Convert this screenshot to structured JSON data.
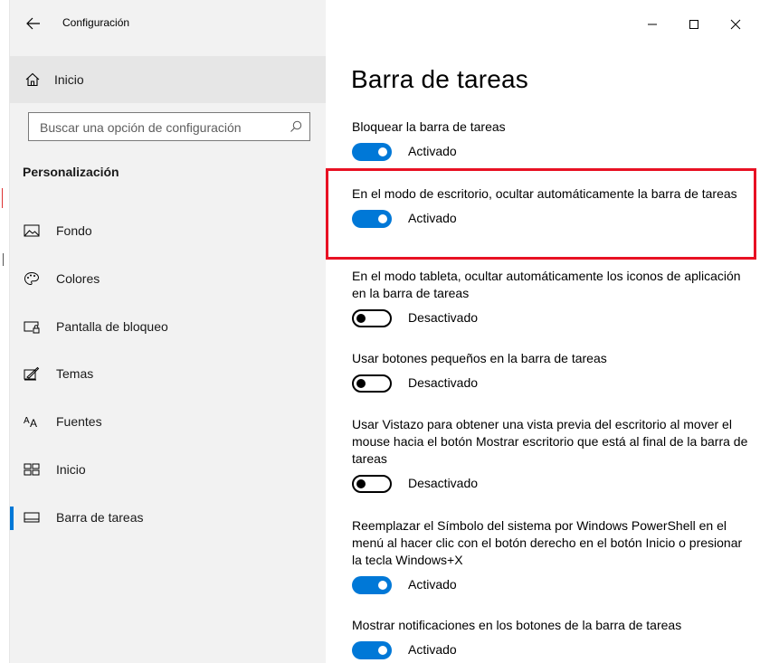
{
  "window": {
    "title": "Configuración",
    "controls": [
      "minimize-icon",
      "maximize-icon",
      "close-icon"
    ]
  },
  "sidebar": {
    "home_label": "Inicio",
    "search_placeholder": "Buscar una opción de configuración",
    "section_title": "Personalización",
    "items": [
      {
        "label": "Fondo",
        "icon": "picture-icon"
      },
      {
        "label": "Colores",
        "icon": "palette-icon"
      },
      {
        "label": "Pantalla de bloqueo",
        "icon": "lock-screen-icon"
      },
      {
        "label": "Temas",
        "icon": "themes-icon"
      },
      {
        "label": "Fuentes",
        "icon": "fonts-icon"
      },
      {
        "label": "Inicio",
        "icon": "start-menu-icon"
      },
      {
        "label": "Barra de tareas",
        "icon": "taskbar-icon",
        "active": true
      }
    ]
  },
  "main": {
    "title": "Barra de tareas",
    "settings": [
      {
        "description": "Bloquear la barra de tareas",
        "state": "on",
        "state_label": "Activado"
      },
      {
        "description": "En el modo de escritorio, ocultar automáticamente la barra de tareas",
        "state": "on",
        "state_label": "Activado",
        "highlighted": true
      },
      {
        "description": "En el modo tableta, ocultar automáticamente los iconos de aplicación en la barra de tareas",
        "state": "off",
        "state_label": "Desactivado"
      },
      {
        "description": "Usar botones pequeños en la barra de tareas",
        "state": "off",
        "state_label": "Desactivado"
      },
      {
        "description": "Usar Vistazo para obtener una vista previa del escritorio al mover el mouse hacia el botón Mostrar escritorio que está al final de la barra de tareas",
        "state": "off",
        "state_label": "Desactivado"
      },
      {
        "description": "Reemplazar el Símbolo del sistema por Windows PowerShell en el menú al hacer clic con el botón derecho en el botón Inicio o presionar la tecla Windows+X",
        "state": "on",
        "state_label": "Activado"
      },
      {
        "description": "Mostrar notificaciones en los botones de la barra de tareas",
        "state": "on",
        "state_label": "Activado"
      }
    ]
  },
  "colors": {
    "accent": "#0078d7",
    "sidebar_bg": "#f2f2f2",
    "highlight_border": "#e81123"
  }
}
